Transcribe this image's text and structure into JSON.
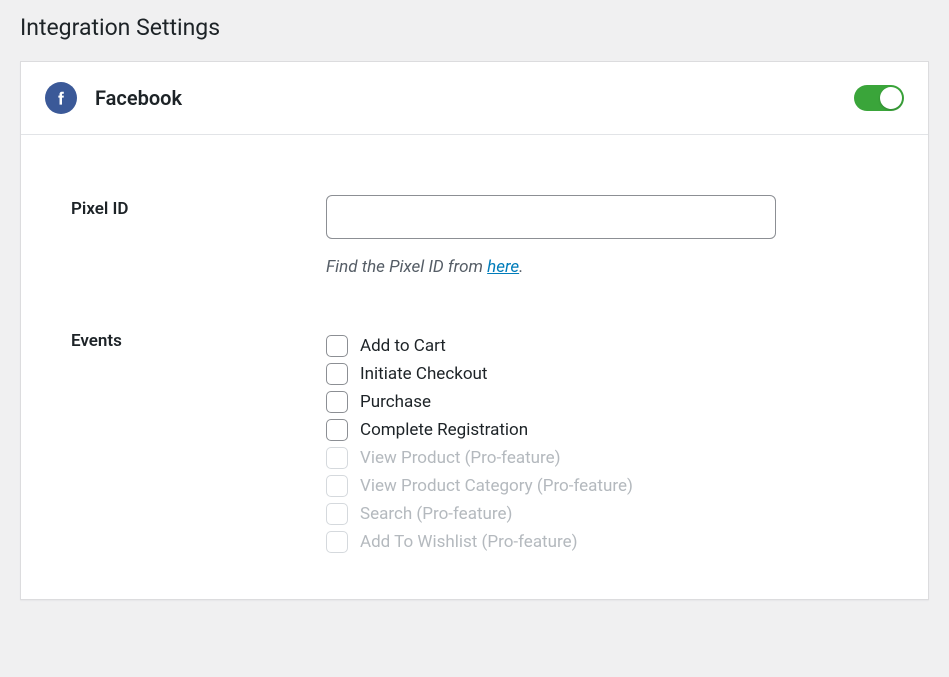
{
  "page": {
    "title": "Integration Settings"
  },
  "integration": {
    "name": "Facebook",
    "enabled": true
  },
  "pixel": {
    "label": "Pixel ID",
    "value": "",
    "helper_prefix": "Find the Pixel ID from ",
    "helper_link_text": "here",
    "helper_suffix": "."
  },
  "events": {
    "label": "Events",
    "items": [
      {
        "label": "Add to Cart",
        "checked": false,
        "disabled": false
      },
      {
        "label": "Initiate Checkout",
        "checked": false,
        "disabled": false
      },
      {
        "label": "Purchase",
        "checked": false,
        "disabled": false
      },
      {
        "label": "Complete Registration",
        "checked": false,
        "disabled": false
      },
      {
        "label": "View Product (Pro-feature)",
        "checked": false,
        "disabled": true
      },
      {
        "label": "View Product Category (Pro-feature)",
        "checked": false,
        "disabled": true
      },
      {
        "label": "Search (Pro-feature)",
        "checked": false,
        "disabled": true
      },
      {
        "label": "Add To Wishlist (Pro-feature)",
        "checked": false,
        "disabled": true
      }
    ]
  }
}
